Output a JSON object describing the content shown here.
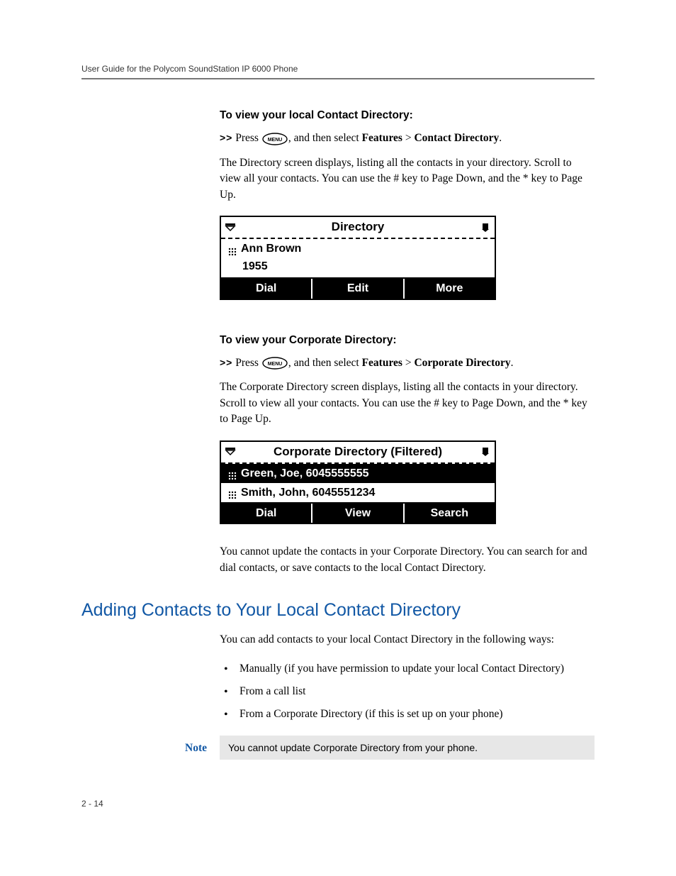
{
  "header": {
    "running_head": "User Guide for the Polycom SoundStation IP 6000 Phone"
  },
  "sect1": {
    "heading": "To view your local Contact Directory:",
    "step_prefix": ">>",
    "step_press": "Press ",
    "step_after_icon": ", and then select ",
    "step_bold1": "Features",
    "step_gt": " > ",
    "step_bold2": "Contact Directory",
    "step_end": ".",
    "para": "The Directory screen displays, listing all the contacts in your directory. Scroll to view all your contacts. You can use the # key to Page Down, and the * key to Page Up."
  },
  "lcd1": {
    "title": "Directory",
    "row_name": "Ann Brown",
    "row_number": "1955",
    "sk1": "Dial",
    "sk2": "Edit",
    "sk3": "More"
  },
  "sect2": {
    "heading": "To view your Corporate Directory:",
    "step_prefix": ">>",
    "step_press": "Press ",
    "step_after_icon": ", and then select ",
    "step_bold1": "Features",
    "step_gt": " > ",
    "step_bold2": "Corporate Directory",
    "step_end": ".",
    "para": "The Corporate Directory screen displays, listing all the contacts in your directory. Scroll to view all your contacts. You can use the # key to Page Down, and the * key to Page Up."
  },
  "lcd2": {
    "title": "Corporate Directory (Filtered)",
    "row1": "Green, Joe, 6045555555",
    "row2": "Smith, John, 6045551234",
    "sk1": "Dial",
    "sk2": "View",
    "sk3": "Search"
  },
  "after_lcd2": "You cannot update the contacts in your Corporate Directory. You can search for and dial contacts, or save contacts to the local Contact Directory.",
  "section_h2": "Adding Contacts to Your Local Contact Directory",
  "intro": "You can add contacts to your local Contact Directory in the following ways:",
  "bullets": {
    "b1": "Manually (if you have permission to update your local Contact Directory)",
    "b2": "From a call list",
    "b3": "From a Corporate Directory (if this is set up on your phone)"
  },
  "note": {
    "label": "Note",
    "text": "You cannot update Corporate Directory from your phone."
  },
  "footer": {
    "page": "2 - 14"
  }
}
